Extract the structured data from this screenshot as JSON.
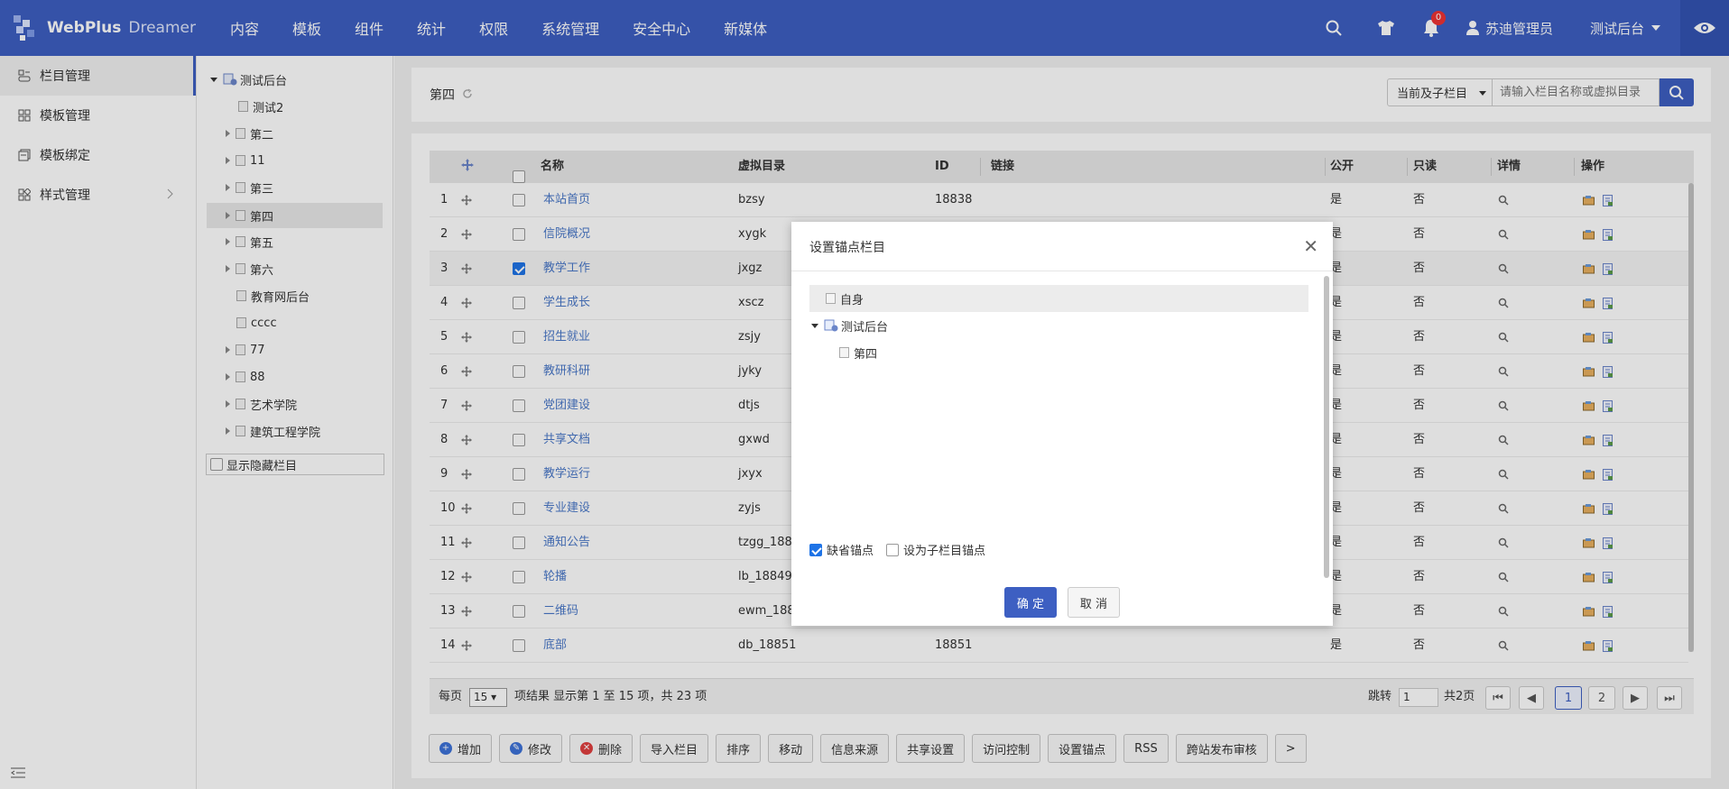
{
  "header": {
    "brand": "WebPlus",
    "brand_sub": "Dreamer",
    "nav": [
      "内容",
      "模板",
      "组件",
      "统计",
      "权限",
      "系统管理",
      "安全中心",
      "新媒体"
    ],
    "notification_count": "0",
    "user": "苏迪管理员",
    "site": "测试后台"
  },
  "sidebar": {
    "items": [
      "栏目管理",
      "模板管理",
      "模板绑定",
      "样式管理"
    ]
  },
  "tree": {
    "root": "测试后台",
    "nodes": [
      "测试2",
      "第二",
      "11",
      "第三",
      "第四",
      "第五",
      "第六",
      "教育网后台",
      "cccc",
      "77",
      "88",
      "艺术学院",
      "建筑工程学院"
    ],
    "show_hidden": "显示隐藏栏目"
  },
  "main": {
    "breadcrumb": "第四",
    "scope_select": "当前及子栏目",
    "search_placeholder": "请输入栏目名称或虚拟目录"
  },
  "table": {
    "headers": [
      "名称",
      "虚拟目录",
      "ID",
      "链接",
      "公开",
      "只读",
      "详情",
      "操作"
    ],
    "rows": [
      {
        "n": "1",
        "name": "本站首页",
        "dir": "bzsy",
        "id": "18838",
        "pub": "是",
        "ro": "否"
      },
      {
        "n": "2",
        "name": "信院概况",
        "dir": "xygk",
        "id": "",
        "pub": "是",
        "ro": "否"
      },
      {
        "n": "3",
        "name": "教学工作",
        "dir": "jxgz",
        "id": "",
        "pub": "是",
        "ro": "否"
      },
      {
        "n": "4",
        "name": "学生成长",
        "dir": "xscz",
        "id": "",
        "pub": "是",
        "ro": "否"
      },
      {
        "n": "5",
        "name": "招生就业",
        "dir": "zsjy",
        "id": "",
        "pub": "是",
        "ro": "否"
      },
      {
        "n": "6",
        "name": "教研科研",
        "dir": "jyky",
        "id": "",
        "pub": "是",
        "ro": "否"
      },
      {
        "n": "7",
        "name": "党团建设",
        "dir": "dtjs",
        "id": "",
        "pub": "是",
        "ro": "否"
      },
      {
        "n": "8",
        "name": "共享文档",
        "dir": "gxwd",
        "id": "",
        "pub": "是",
        "ro": "否"
      },
      {
        "n": "9",
        "name": "教学运行",
        "dir": "jxyx",
        "id": "",
        "pub": "是",
        "ro": "否"
      },
      {
        "n": "10",
        "name": "专业建设",
        "dir": "zyjs",
        "id": "",
        "pub": "是",
        "ro": "否"
      },
      {
        "n": "11",
        "name": "通知公告",
        "dir": "tzgg_1884",
        "id": "",
        "pub": "是",
        "ro": "否"
      },
      {
        "n": "12",
        "name": "轮播",
        "dir": "lb_18849",
        "id": "",
        "pub": "是",
        "ro": "否"
      },
      {
        "n": "13",
        "name": "二维码",
        "dir": "ewm_188",
        "id": "",
        "pub": "是",
        "ro": "否"
      },
      {
        "n": "14",
        "name": "底部",
        "dir": "db_18851",
        "id": "18851",
        "pub": "是",
        "ro": "否"
      }
    ]
  },
  "pager": {
    "per_page_label": "每页",
    "per_page": "15",
    "summary": "项结果 显示第 1 至 15 项，共 23 项",
    "jump_label": "跳转",
    "jump_value": "1",
    "total_pages": "共2页",
    "pages": [
      "1",
      "2"
    ]
  },
  "actions": [
    "增加",
    "修改",
    "删除",
    "导入栏目",
    "排序",
    "移动",
    "信息来源",
    "共享设置",
    "访问控制",
    "设置锚点",
    "RSS",
    "跨站发布审核",
    ">"
  ],
  "dialog": {
    "title": "设置锚点栏目",
    "tree": [
      "自身",
      "测试后台",
      "第四"
    ],
    "opt_default": "缺省锚点",
    "opt_child": "设为子栏目锚点",
    "ok": "确 定",
    "cancel": "取 消"
  },
  "colors": {
    "primary": "#3d5fc2",
    "link": "#4a78c8"
  }
}
